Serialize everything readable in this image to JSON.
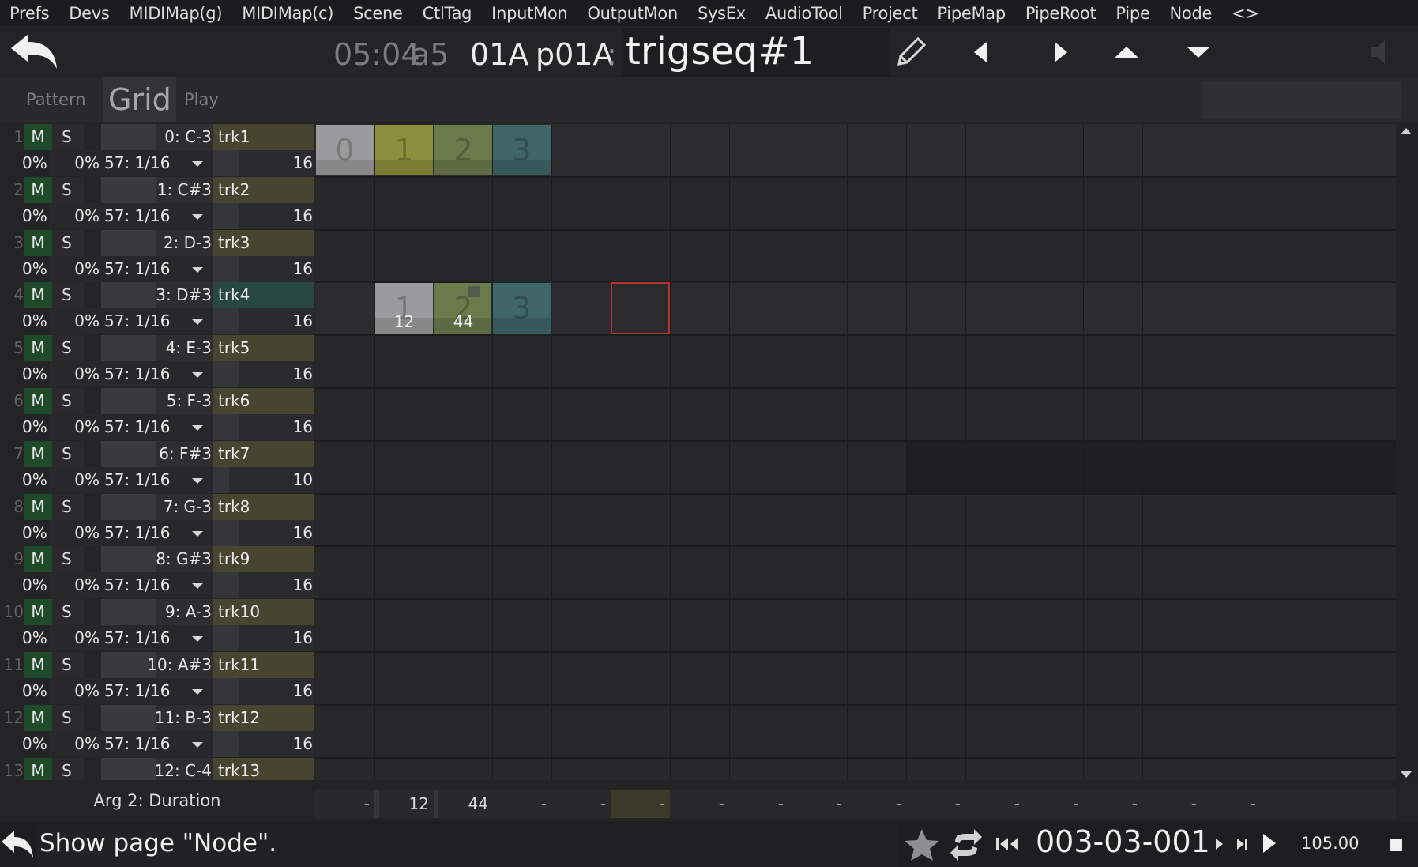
{
  "menu": [
    "Prefs",
    "Devs",
    "MIDIMap(g)",
    "MIDIMap(c)",
    "Scene",
    "CtlTag",
    "InputMon",
    "OutputMon",
    "SysEx",
    "AudioTool",
    "Project",
    "PipeMap",
    "PipeRoot",
    "Pipe",
    "Node",
    "<>"
  ],
  "header": {
    "time": "05:04",
    "slot": "a5",
    "pattern_id": "01A",
    "pattern_name": "p01A",
    "separator": ":",
    "node_name": "trigseq#1",
    "icons": [
      "back-arrow-icon",
      "pencil-icon",
      "triangle-left-icon",
      "triangle-right-icon",
      "triangle-up-icon",
      "triangle-down-icon",
      "speaker-icon"
    ]
  },
  "tabs": {
    "pattern": "Pattern",
    "grid": "Grid",
    "play": "Play"
  },
  "tracks": [
    {
      "num": "1",
      "mute": "M",
      "solo": "S",
      "note": "0: C-3",
      "name": "trk1",
      "p1": "0%",
      "p2": "0%",
      "div": "57: 1/16",
      "len": "16",
      "len_fraction": 0.25
    },
    {
      "num": "2",
      "mute": "M",
      "solo": "S",
      "note": "1: C#3",
      "name": "trk2",
      "p1": "0%",
      "p2": "0%",
      "div": "57: 1/16",
      "len": "16",
      "len_fraction": 0.25
    },
    {
      "num": "3",
      "mute": "M",
      "solo": "S",
      "note": "2: D-3",
      "name": "trk3",
      "p1": "0%",
      "p2": "0%",
      "div": "57: 1/16",
      "len": "16",
      "len_fraction": 0.25
    },
    {
      "num": "4",
      "mute": "M",
      "solo": "S",
      "note": "3: D#3",
      "name": "trk4",
      "p1": "0%",
      "p2": "0%",
      "div": "57: 1/16",
      "len": "16",
      "len_fraction": 0.25
    },
    {
      "num": "5",
      "mute": "M",
      "solo": "S",
      "note": "4: E-3",
      "name": "trk5",
      "p1": "0%",
      "p2": "0%",
      "div": "57: 1/16",
      "len": "16",
      "len_fraction": 0.25
    },
    {
      "num": "6",
      "mute": "M",
      "solo": "S",
      "note": "5: F-3",
      "name": "trk6",
      "p1": "0%",
      "p2": "0%",
      "div": "57: 1/16",
      "len": "16",
      "len_fraction": 0.25
    },
    {
      "num": "7",
      "mute": "M",
      "solo": "S",
      "note": "6: F#3",
      "name": "trk7",
      "p1": "0%",
      "p2": "0%",
      "div": "57: 1/16",
      "len": "10",
      "len_fraction": 0.16
    },
    {
      "num": "8",
      "mute": "M",
      "solo": "S",
      "note": "7: G-3",
      "name": "trk8",
      "p1": "0%",
      "p2": "0%",
      "div": "57: 1/16",
      "len": "16",
      "len_fraction": 0.25
    },
    {
      "num": "9",
      "mute": "M",
      "solo": "S",
      "note": "8: G#3",
      "name": "trk9",
      "p1": "0%",
      "p2": "0%",
      "div": "57: 1/16",
      "len": "16",
      "len_fraction": 0.25
    },
    {
      "num": "10",
      "mute": "M",
      "solo": "S",
      "note": "9: A-3",
      "name": "trk10",
      "p1": "0%",
      "p2": "0%",
      "div": "57: 1/16",
      "len": "16",
      "len_fraction": 0.25
    },
    {
      "num": "11",
      "mute": "M",
      "solo": "S",
      "note": "10: A#3",
      "name": "trk11",
      "p1": "0%",
      "p2": "0%",
      "div": "57: 1/16",
      "len": "16",
      "len_fraction": 0.25
    },
    {
      "num": "12",
      "mute": "M",
      "solo": "S",
      "note": "11: B-3",
      "name": "trk12",
      "p1": "0%",
      "p2": "0%",
      "div": "57: 1/16",
      "len": "16",
      "len_fraction": 0.25
    },
    {
      "num": "13",
      "mute": "M",
      "solo": "S",
      "note": "12: C-4",
      "name": "trk13",
      "p1": "",
      "p2": "",
      "div": "",
      "len": "",
      "len_fraction": 0.25
    }
  ],
  "selected_track_index": 3,
  "grid": {
    "columns": 16,
    "cells": [
      {
        "track": 0,
        "step": 0,
        "label": "0",
        "value": "",
        "color": "#9b9b9d"
      },
      {
        "track": 0,
        "step": 1,
        "label": "1",
        "value": "",
        "color": "#8e8f3c"
      },
      {
        "track": 0,
        "step": 2,
        "label": "2",
        "value": "",
        "color": "#6c7a4c"
      },
      {
        "track": 0,
        "step": 3,
        "label": "3",
        "value": "",
        "color": "#3f6668"
      },
      {
        "track": 3,
        "step": 1,
        "label": "1",
        "value": "12",
        "color": "#9b9b9d"
      },
      {
        "track": 3,
        "step": 2,
        "label": "2",
        "value": "44",
        "color": "#6c7a4c"
      },
      {
        "track": 3,
        "step": 3,
        "label": "3",
        "value": "",
        "color": "#3f6668"
      }
    ],
    "cursor": {
      "track": 3,
      "step": 5
    }
  },
  "arg": {
    "label": "Arg 2: Duration",
    "values": [
      "-",
      "12",
      "44",
      "-",
      "-",
      "-",
      "-",
      "-",
      "-",
      "-",
      "-",
      "-",
      "-",
      "-",
      "-",
      "-"
    ],
    "highlight_step": 5
  },
  "status": {
    "message": "Show page \"Node\".",
    "song_position": "003-03-001",
    "tempo": "105.00",
    "icons": [
      "undo-arrow-icon",
      "star-icon",
      "loop-icon",
      "rewind-icon",
      "step-forward-icon",
      "skip-end-icon",
      "play-icon",
      "stop-icon"
    ]
  },
  "colors": {
    "mute_on": "#1f4a29",
    "track_name": "#46452f",
    "track_name_selected": "#28483f",
    "cursor": "#b0352c"
  }
}
